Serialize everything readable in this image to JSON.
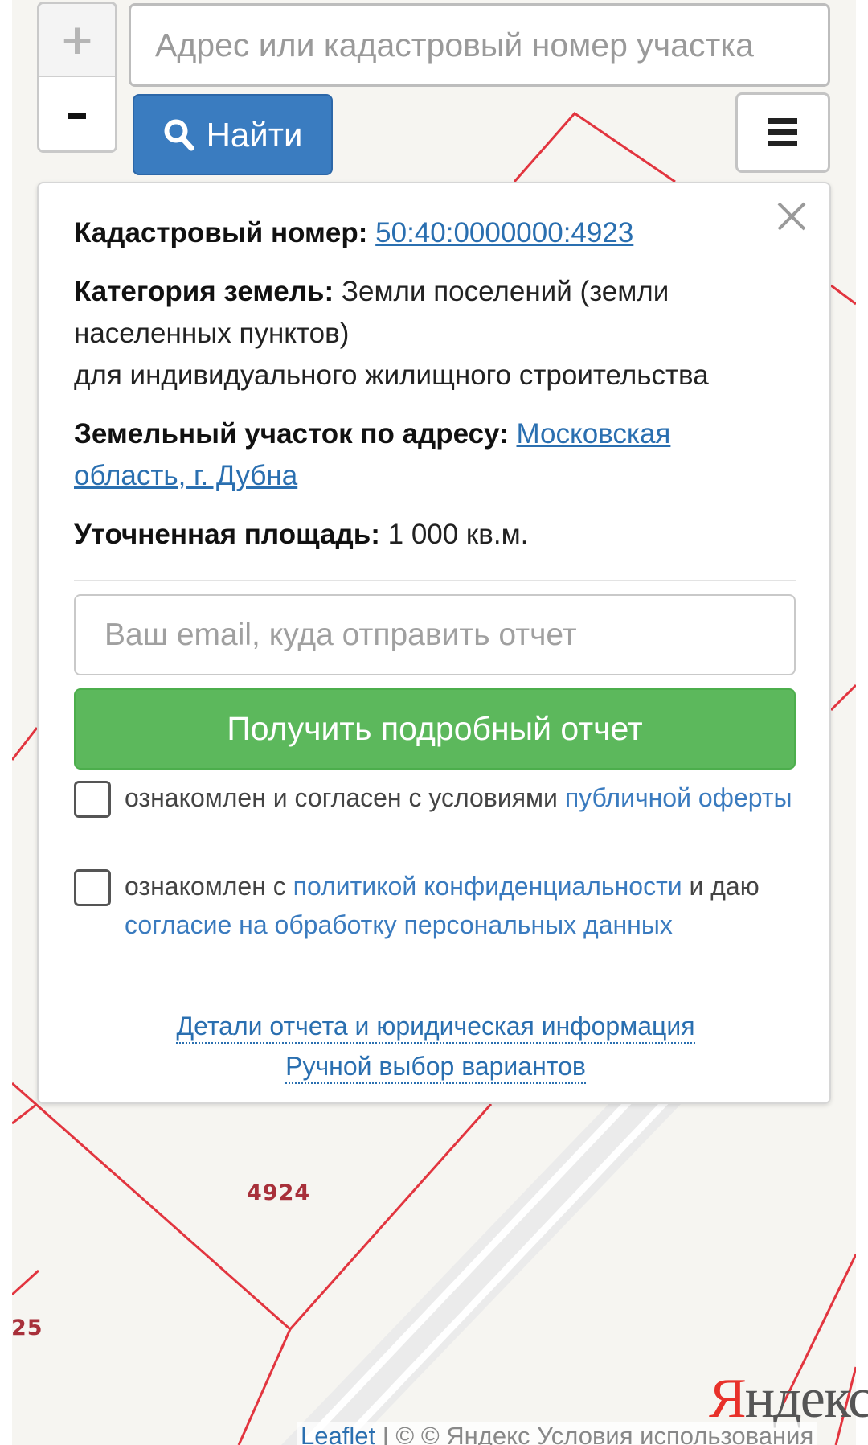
{
  "map": {
    "parcel_labels": [
      "4924",
      "25"
    ],
    "attribution": {
      "leaflet": "Leaflet",
      "separator": "| ©",
      "yandex_copyright": "© Яндекс",
      "terms_link": "Условия использования"
    },
    "logo_text": {
      "first": "Я",
      "rest": "ндекс"
    },
    "colors": {
      "parcel_line": "#e2353f",
      "road": "#ffffff"
    }
  },
  "zoom": {
    "in_label": "+",
    "out_label": "–"
  },
  "search": {
    "placeholder": "Адрес или кадастровый номер участка",
    "button_label": "Найти"
  },
  "menu": {
    "icon": "hamburger-icon"
  },
  "panel": {
    "cadastral_number_label": "Кадастровый номер:",
    "cadastral_number": "50:40:0000000:4923",
    "land_category_label": "Категория земель:",
    "land_category_value": "Земли поселений (земли населенных пунктов)",
    "land_use": "для индивидуального жилищного строительства",
    "address_label": "Земельный участок по адресу:",
    "address_value": "Московская область, г. Дубна",
    "area_label": "Уточненная площадь:",
    "area_value": "1 000 кв.м.",
    "email_placeholder": "Ваш email, куда отправить отчет",
    "report_button": "Получить подробный отчет",
    "consent_offer_text": "ознакомлен и согласен с условиями",
    "consent_offer_link": "публичной оферты",
    "consent_privacy_text_1": "ознакомлен с",
    "consent_privacy_link_1": "политикой конфиденциальности",
    "consent_privacy_text_2": "и даю",
    "consent_privacy_link_2": "согласие на обработку персональных данных",
    "details_link": "Детали отчета и юридическая информация",
    "manual_link": "Ручной выбор вариантов",
    "colors": {
      "link": "#2a6fb0",
      "primary_button": "#3a7cc0",
      "success_button": "#5cb85c"
    }
  }
}
